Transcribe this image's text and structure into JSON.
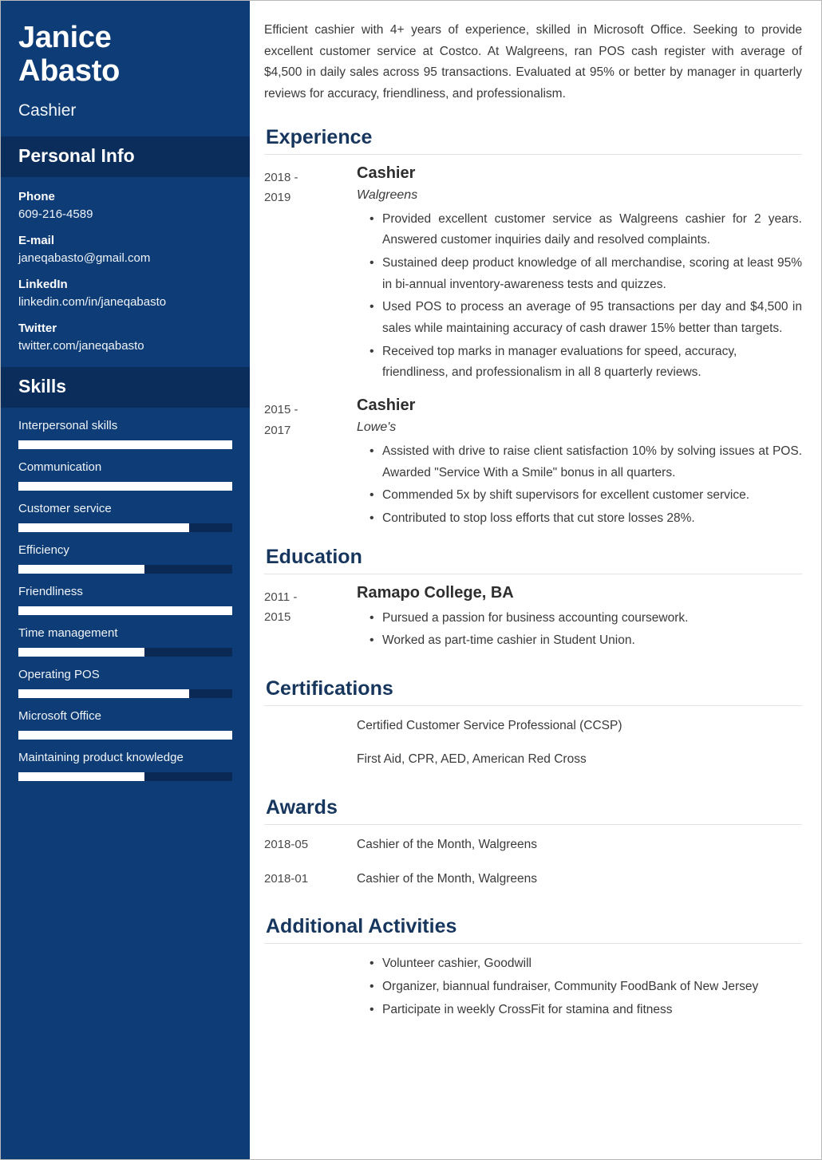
{
  "sidebar": {
    "first_name": "Janice",
    "last_name": "Abasto",
    "job_title": "Cashier",
    "personal_info_heading": "Personal Info",
    "contacts": [
      {
        "label": "Phone",
        "value": "609-216-4589"
      },
      {
        "label": "E-mail",
        "value": "janeqabasto@gmail.com"
      },
      {
        "label": "LinkedIn",
        "value": "linkedin.com/in/janeqabasto"
      },
      {
        "label": "Twitter",
        "value": "twitter.com/janeqabasto"
      }
    ],
    "skills_heading": "Skills",
    "skills": [
      {
        "name": "Interpersonal skills",
        "level": 100
      },
      {
        "name": "Communication",
        "level": 100
      },
      {
        "name": "Customer service",
        "level": 80
      },
      {
        "name": "Efficiency",
        "level": 59
      },
      {
        "name": "Friendliness",
        "level": 100
      },
      {
        "name": "Time management",
        "level": 59
      },
      {
        "name": "Operating POS",
        "level": 80
      },
      {
        "name": "Microsoft Office",
        "level": 100
      },
      {
        "name": "Maintaining product knowledge",
        "level": 59
      }
    ]
  },
  "main": {
    "summary": "Efficient cashier with 4+ years of experience, skilled in Microsoft Office. Seeking to provide excellent customer service at Costco. At Walgreens, ran POS cash register with average of $4,500 in daily sales across 95 transactions. Evaluated at 95% or better by manager in quarterly reviews for accuracy, friendliness, and professionalism.",
    "experience": {
      "heading": "Experience",
      "entries": [
        {
          "date_start": "2018 -",
          "date_end": "2019",
          "role": "Cashier",
          "org": "Walgreens",
          "bullets": [
            "Provided excellent customer service as Walgreens cashier for 2 years. Answered customer inquiries daily and resolved complaints.",
            "Sustained deep product knowledge of all merchandise, scoring at least 95% in bi-annual inventory-awareness tests and quizzes.",
            "Used POS to process an average of 95 transactions per day and $4,500 in sales while maintaining accuracy of cash drawer 15% better than targets.",
            "Received top marks in manager evaluations for speed, accuracy, friendliness, and professionalism in all 8 quarterly reviews."
          ]
        },
        {
          "date_start": "2015 -",
          "date_end": "2017",
          "role": "Cashier",
          "org": "Lowe's",
          "bullets": [
            "Assisted with drive to raise client satisfaction 10% by solving issues at POS. Awarded \"Service With a Smile\" bonus in all quarters.",
            "Commended 5x by shift supervisors for excellent customer service.",
            "Contributed to stop loss efforts that cut store losses 28%."
          ]
        }
      ]
    },
    "education": {
      "heading": "Education",
      "entries": [
        {
          "date_start": "2011 -",
          "date_end": "2015",
          "school": "Ramapo College, BA",
          "bullets": [
            "Pursued a passion for business accounting coursework.",
            "Worked as part-time cashier in Student Union."
          ]
        }
      ]
    },
    "certifications": {
      "heading": "Certifications",
      "items": [
        "Certified Customer Service Professional (CCSP)",
        "First Aid, CPR, AED, American Red Cross"
      ]
    },
    "awards": {
      "heading": "Awards",
      "items": [
        {
          "date": "2018-05",
          "text": "Cashier of the Month, Walgreens"
        },
        {
          "date": "2018-01",
          "text": "Cashier of the Month, Walgreens"
        }
      ]
    },
    "additional_activities": {
      "heading": "Additional Activities",
      "items": [
        "Volunteer cashier, Goodwill",
        "Organizer, biannual fundraiser, Community FoodBank of New Jersey",
        "Participate in weekly CrossFit for stamina and fitness"
      ]
    }
  },
  "colors": {
    "sidebar_bg": "#0d3c77",
    "sidebar_band": "#0a2d5c",
    "heading": "#17365d",
    "skill_track": "#0a2a55",
    "skill_fill": "#ffffff"
  }
}
